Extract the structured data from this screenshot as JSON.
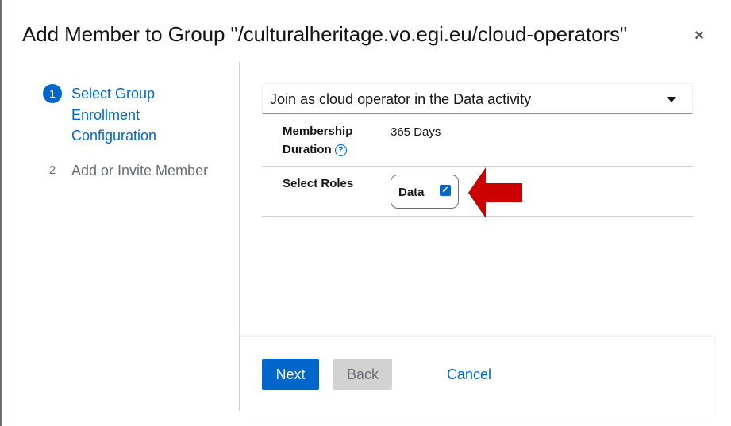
{
  "modal": {
    "title": "Add Member to Group \"/culturalheritage.vo.egi.eu/cloud-operators\"",
    "close_glyph": "×"
  },
  "wizard": {
    "steps": [
      {
        "number": "1",
        "label": "Select Group Enrollment Configuration",
        "current": true
      },
      {
        "number": "2",
        "label": "Add or Invite Member",
        "current": false
      }
    ]
  },
  "form": {
    "enrollment_select": {
      "value": "Join as cloud operator in the Data activity"
    },
    "membership_duration": {
      "label": "Membership Duration",
      "value": "365 Days",
      "help_icon": "question-circle-icon"
    },
    "select_roles": {
      "label": "Select Roles",
      "roles": [
        {
          "label": "Data",
          "checked": true
        }
      ]
    }
  },
  "annotation": {
    "arrow_color": "#cc0000",
    "arrow_icon": "left-arrow-icon"
  },
  "footer": {
    "next_label": "Next",
    "back_label": "Back",
    "cancel_label": "Cancel"
  },
  "colors": {
    "accent": "#0066cc",
    "disabled": "#d2d2d2",
    "text": "#151515",
    "muted": "#6a6e73"
  }
}
